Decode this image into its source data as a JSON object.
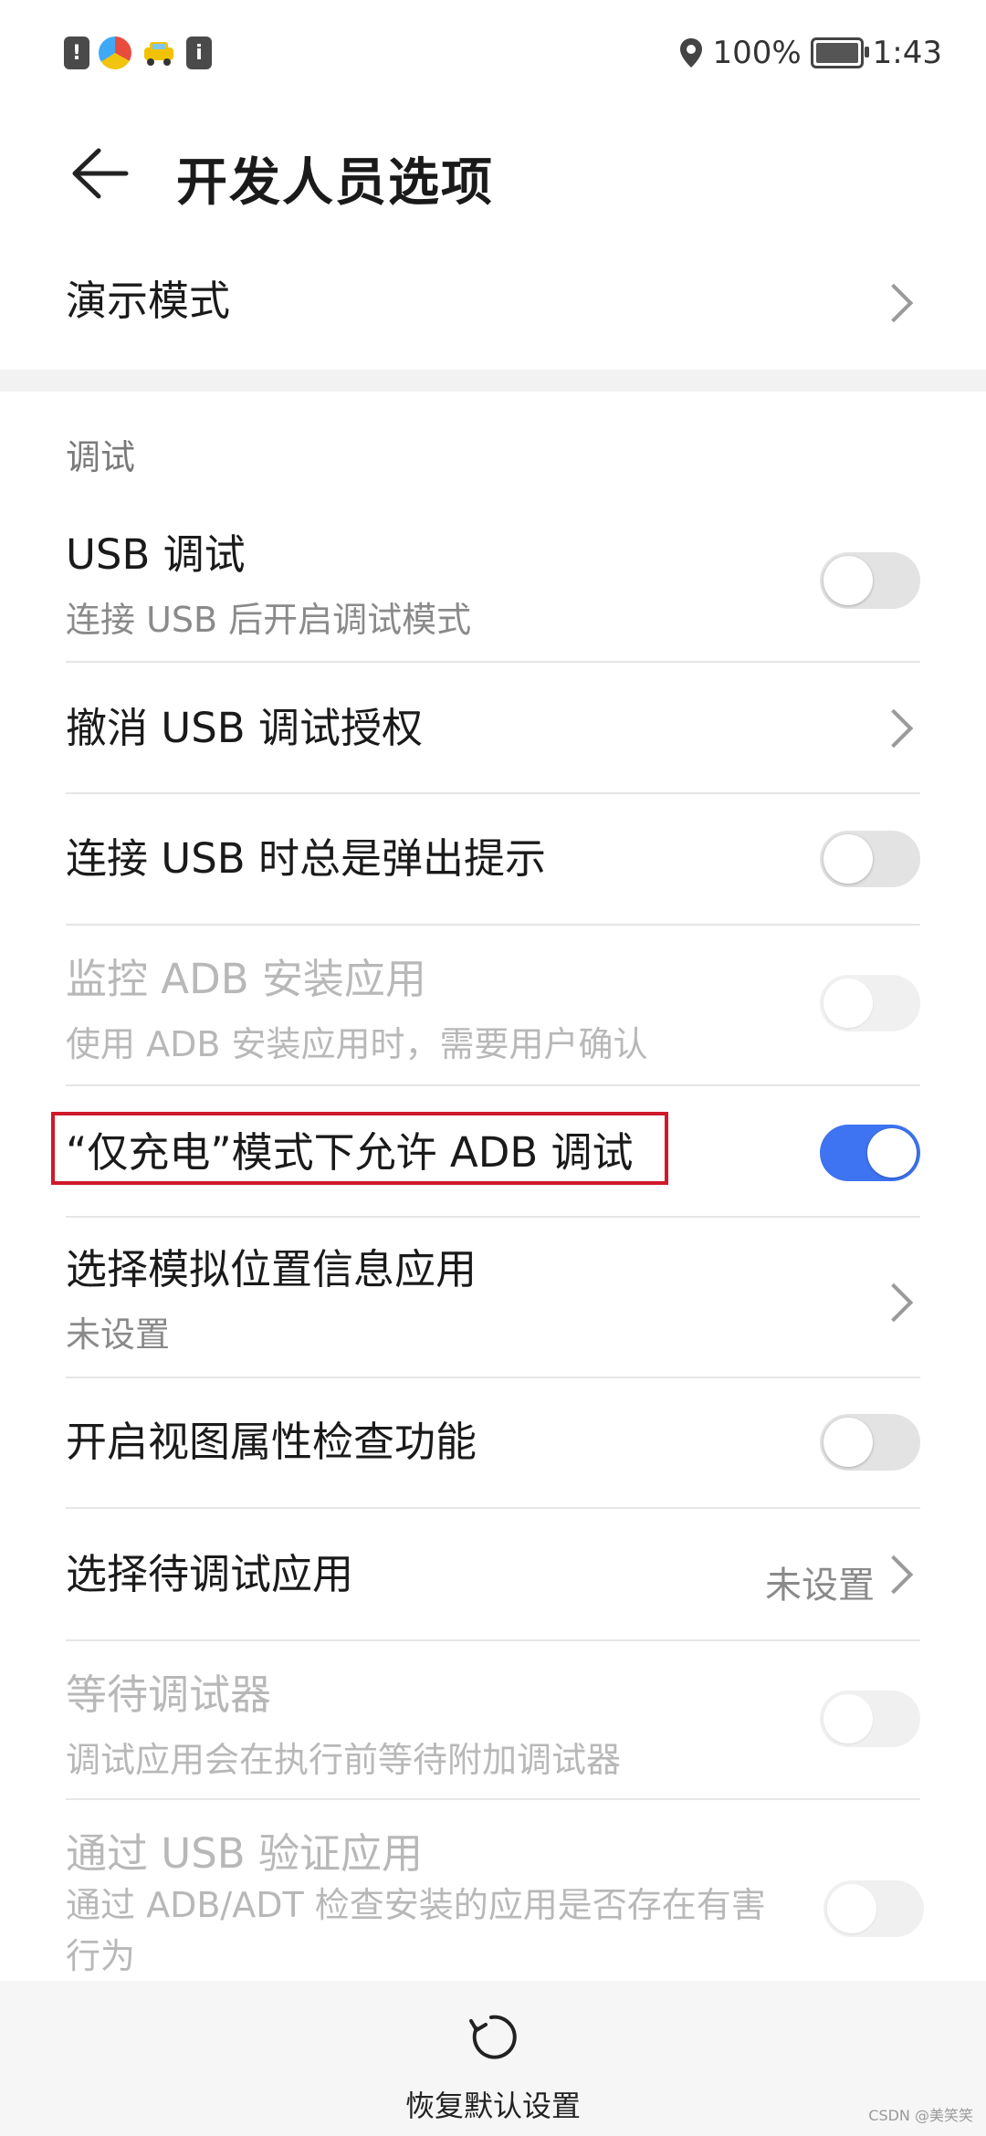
{
  "status_bar": {
    "battery_percent": "100%",
    "time": "1:43",
    "icons": [
      "alert-icon",
      "browser-icon",
      "taxi-icon",
      "info-icon",
      "location-icon",
      "battery-charging-icon"
    ]
  },
  "header": {
    "title": "开发人员选项",
    "back_icon": "back-arrow-icon"
  },
  "demo_mode": {
    "label": "演示模式"
  },
  "section": {
    "title": "调试"
  },
  "items": [
    {
      "label": "USB 调试",
      "sub": "连接 USB 后开启调试模式",
      "control": "toggle",
      "on": false,
      "enabled": true
    },
    {
      "label": "撤消 USB 调试授权",
      "control": "chevron"
    },
    {
      "label": "连接 USB 时总是弹出提示",
      "control": "toggle",
      "on": false,
      "enabled": true
    },
    {
      "label": "监控 ADB 安装应用",
      "sub": "使用 ADB 安装应用时，需要用户确认",
      "control": "toggle",
      "on": false,
      "enabled": false
    },
    {
      "label": "“仅充电”模式下允许 ADB 调试",
      "control": "toggle",
      "on": true,
      "enabled": true
    },
    {
      "label": "选择模拟位置信息应用",
      "sub": "未设置",
      "control": "chevron"
    },
    {
      "label": "开启视图属性检查功能",
      "control": "toggle",
      "on": false,
      "enabled": true
    },
    {
      "label": "选择待调试应用",
      "value": "未设置",
      "control": "chevron"
    },
    {
      "label": "等待调试器",
      "sub": "调试应用会在执行前等待附加调试器",
      "control": "toggle",
      "on": false,
      "enabled": false
    },
    {
      "label": "通过 USB 验证应用",
      "sub": "通过 ADB/ADT 检查安装的应用是否存在有害行为",
      "control": "toggle",
      "on": false,
      "enabled": false
    }
  ],
  "bottom": {
    "reset_label": "恢复默认设置",
    "reset_icon": "refresh-icon"
  },
  "watermark": "CSDN @美笑笑",
  "colors": {
    "accent": "#3e73f1",
    "highlight_border": "#d0192b"
  }
}
